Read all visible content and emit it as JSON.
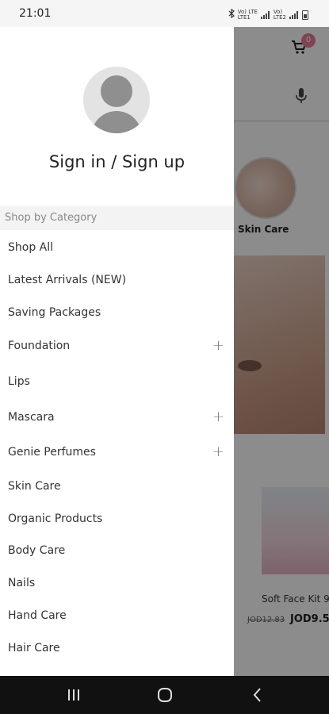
{
  "status_bar": {
    "time": "21:01",
    "network_1": "Vo) LTE\nLTE1",
    "network_2": "Vo)\nLTE2",
    "icons": [
      "bluetooth-icon",
      "signal-icon",
      "battery-icon"
    ]
  },
  "background_app": {
    "cart_count": "0",
    "category_label": "Skin Care",
    "product_name": "Soft Face Kit 9",
    "old_price": "JOD12.83",
    "new_price": "JOD9.5"
  },
  "drawer": {
    "sign_in_label": "Sign in / Sign up",
    "section_header": "Shop by Category",
    "items": [
      {
        "label": "Shop All",
        "expandable": false
      },
      {
        "label": "Latest Arrivals (NEW)",
        "expandable": false
      },
      {
        "label": "Saving Packages",
        "expandable": false
      },
      {
        "label": "Foundation",
        "expandable": true
      },
      {
        "label": "Lips",
        "expandable": false
      },
      {
        "label": "Mascara",
        "expandable": true
      },
      {
        "label": "Genie Perfumes",
        "expandable": true
      },
      {
        "label": "Skin Care",
        "expandable": false
      },
      {
        "label": "Organic Products",
        "expandable": false
      },
      {
        "label": "Body Care",
        "expandable": false
      },
      {
        "label": "Nails",
        "expandable": false
      },
      {
        "label": "Hand Care",
        "expandable": false
      },
      {
        "label": "Hair Care",
        "expandable": false
      }
    ],
    "expand_symbol": "+"
  },
  "colors": {
    "accent_badge": "#e87b9a",
    "drawer_bg": "#ffffff",
    "header_bg": "#f3f3f3"
  }
}
